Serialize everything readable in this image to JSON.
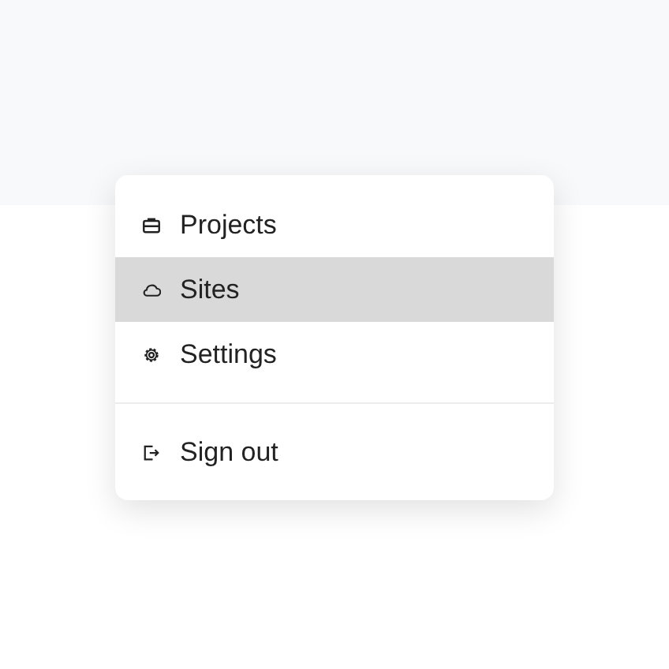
{
  "menu": {
    "items": [
      {
        "label": "Projects",
        "kind": "briefcase",
        "selected": false,
        "divider_before": false
      },
      {
        "label": "Sites",
        "kind": "cloud",
        "selected": true,
        "divider_before": false
      },
      {
        "label": "Settings",
        "kind": "gear",
        "selected": false,
        "divider_before": false
      },
      {
        "label": "Sign out",
        "kind": "exit",
        "selected": false,
        "divider_before": true
      }
    ]
  }
}
